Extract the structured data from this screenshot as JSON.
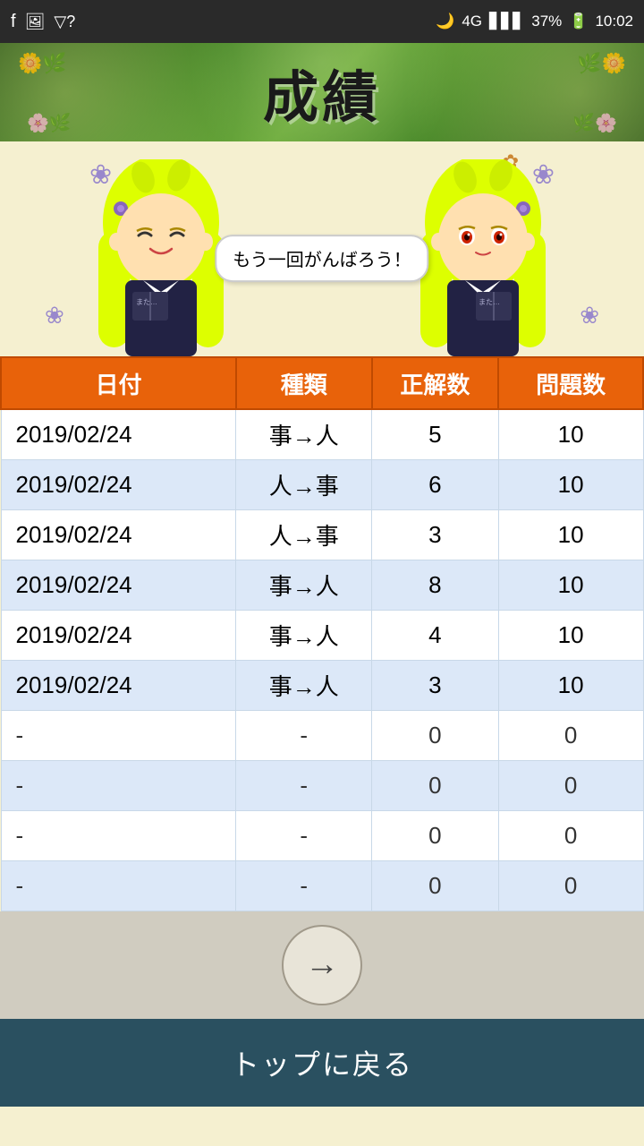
{
  "statusBar": {
    "time": "10:02",
    "battery": "37%",
    "signal": "4G"
  },
  "header": {
    "title": "成績"
  },
  "characterArea": {
    "speechBubble": "もう一回がんばろう！",
    "leftFlower": "🌸",
    "rightFlower": "🌸"
  },
  "table": {
    "headers": {
      "date": "日付",
      "type": "種類",
      "correct": "正解数",
      "total": "問題数"
    },
    "rows": [
      {
        "date": "2019/02/24",
        "type": "事→人",
        "correct": "5",
        "total": "10",
        "empty": false
      },
      {
        "date": "2019/02/24",
        "type": "人→事",
        "correct": "6",
        "total": "10",
        "empty": false
      },
      {
        "date": "2019/02/24",
        "type": "人→事",
        "correct": "3",
        "total": "10",
        "empty": false
      },
      {
        "date": "2019/02/24",
        "type": "事→人",
        "correct": "8",
        "total": "10",
        "empty": false
      },
      {
        "date": "2019/02/24",
        "type": "事→人",
        "correct": "4",
        "total": "10",
        "empty": false
      },
      {
        "date": "2019/02/24",
        "type": "事→人",
        "correct": "3",
        "total": "10",
        "empty": false
      },
      {
        "date": "-",
        "type": "-",
        "correct": "0",
        "total": "0",
        "empty": true
      },
      {
        "date": "-",
        "type": "-",
        "correct": "0",
        "total": "0",
        "empty": true
      },
      {
        "date": "-",
        "type": "-",
        "correct": "0",
        "total": "0",
        "empty": true
      },
      {
        "date": "-",
        "type": "-",
        "correct": "0",
        "total": "0",
        "empty": true
      }
    ]
  },
  "navigation": {
    "arrow": "→"
  },
  "bottomButton": {
    "label": "トップに戻る"
  }
}
